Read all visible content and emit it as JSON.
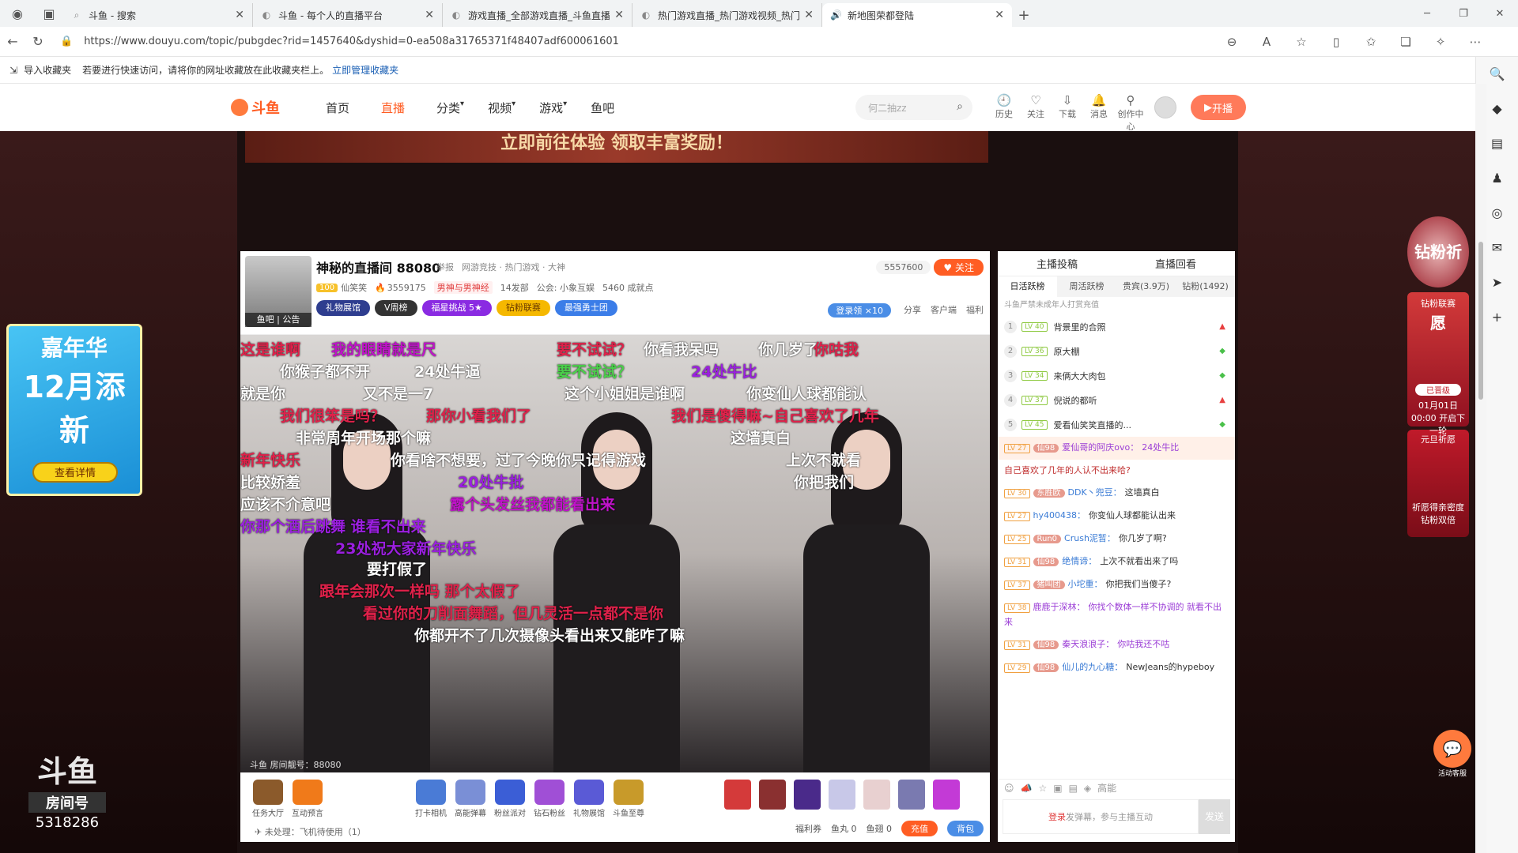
{
  "browser": {
    "tabs": [
      {
        "title": "斗鱼 - 搜索",
        "icon": "search-icon"
      },
      {
        "title": "斗鱼 - 每个人的直播平台",
        "icon": "douyu-icon"
      },
      {
        "title": "游戏直播_全部游戏直播_斗鱼直播",
        "icon": "douyu-icon"
      },
      {
        "title": "热门游戏直播_热门游戏视频_热门",
        "icon": "douyu-icon"
      },
      {
        "title": "新地图荣都登陆",
        "icon": "speaker-icon"
      }
    ],
    "url": "https://www.douyu.com/topic/pubgdec?rid=1457640&dyshid=0-ea508a31765371f48407adf600061601",
    "bookmarks": {
      "import": "导入收藏夹",
      "hint": "若要进行快速访问，请将你的网址收藏放在此收藏夹栏上。",
      "manage": "立即管理收藏夹"
    }
  },
  "site": {
    "logo": "斗鱼",
    "nav": [
      "首页",
      "直播",
      "分类",
      "视频",
      "游戏",
      "鱼吧"
    ],
    "active_nav": "直播",
    "search_placeholder": "何二抽zz",
    "top_icons": [
      "历史",
      "关注",
      "下载",
      "消息",
      "创作中心"
    ],
    "live_btn": "开播"
  },
  "banner_top": "立即前往体验 领取丰富奖励！",
  "left_promo": {
    "title": "嘉年华",
    "sub": "12月添新",
    "btn": "查看详情"
  },
  "room_number": {
    "logo": "斗鱼",
    "label": "房间号",
    "value": "5318286"
  },
  "room": {
    "title": "神秘的直播间 88080",
    "report": "举报",
    "category": "网游竞技 · 热门游戏 · 大神",
    "avatar_tag": "鱼吧 | 公告",
    "host_level": "100",
    "host_name": "仙笑笑",
    "hot": "3559175",
    "tag": "男神与男神经",
    "fans_club": "14发部",
    "guild": "公会: 小象互娱",
    "achievements": "5460 成就点",
    "badges": [
      "礼物展馆",
      "V周榜",
      "福星挑战 5★",
      "钻粉联赛",
      "最强勇士团"
    ],
    "follow_count": "5557600",
    "follow_btn": "关注",
    "login_badge": "登录领 ×10",
    "actions": [
      "分享",
      "客户端",
      "福利"
    ]
  },
  "danmaku": [
    {
      "t": "这是谁啊",
      "c": "#e0214a"
    },
    {
      "t": "我的眼睛就是尺",
      "c": "#c013c9"
    },
    {
      "t": "要不试试？",
      "c": "#e0214a"
    },
    {
      "t": "你看我呆吗",
      "c": "#ffffff"
    },
    {
      "t": "你几岁了",
      "c": "#ffffff"
    },
    {
      "t": "你猴子都不开",
      "c": "#ffffff"
    },
    {
      "t": "24处牛逼",
      "c": "#ffffff"
    },
    {
      "t": "要不试试？",
      "c": "#4ad14a"
    },
    {
      "t": "24处牛比",
      "c": "#9b1fe0"
    },
    {
      "t": "你咕我",
      "c": "#e0214a"
    },
    {
      "t": "就是你",
      "c": "#ffffff"
    },
    {
      "t": "又不是一7",
      "c": "#ffffff"
    },
    {
      "t": "这个小姐姐是谁啊",
      "c": "#ffffff"
    },
    {
      "t": "你变仙人球都能认",
      "c": "#ffffff"
    },
    {
      "t": "我们很笨是吗？",
      "c": "#e0214a"
    },
    {
      "t": "那你小看我们了",
      "c": "#e0214a"
    },
    {
      "t": "我们是傻得嘛~自己喜欢了几年",
      "c": "#e0214a"
    },
    {
      "t": "非常周年开场那个嘛",
      "c": "#ffffff"
    },
    {
      "t": "这墙真白",
      "c": "#ffffff"
    },
    {
      "t": "新年快乐",
      "c": "#e0214a"
    },
    {
      "t": "你看啥不想要，过了今晚你只记得游戏",
      "c": "#ffffff"
    },
    {
      "t": "上次不就看",
      "c": "#ffffff"
    },
    {
      "t": "比较娇羞",
      "c": "#ffffff"
    },
    {
      "t": "20处牛批",
      "c": "#9b1fe0"
    },
    {
      "t": "你把我们",
      "c": "#ffffff"
    },
    {
      "t": "应该不介意吧",
      "c": "#ffffff"
    },
    {
      "t": "露个头发丝我都能看出来",
      "c": "#c013c9"
    },
    {
      "t": "你那个酒后跳舞 谁看不出来",
      "c": "#9b1fe0"
    },
    {
      "t": "23处祝大家新年快乐",
      "c": "#9b1fe0"
    },
    {
      "t": "要打假了",
      "c": "#ffffff"
    },
    {
      "t": "跟年会那次一样吗 那个太假了",
      "c": "#e0214a"
    },
    {
      "t": "看过你的刀削面舞蹈，但几灵活一点都不是你",
      "c": "#e0214a"
    },
    {
      "t": "你都开不了几次摄像头看出来又能咋了嘛",
      "c": "#ffffff"
    }
  ],
  "video_watermark": "斗鱼 房间靓号：88080",
  "giftbar": {
    "left": [
      "任务大厅",
      "互动预言"
    ],
    "mid": [
      "打卡相机",
      "高能弹幕",
      "粉丝派对",
      "钻石粉丝",
      "礼物展馆",
      "斗鱼至尊"
    ],
    "pending": "未处理：飞机待使用（1）",
    "wallet": [
      "福利券",
      "鱼丸 0",
      "鱼翅 0"
    ],
    "charge": "充值",
    "bag": "背包"
  },
  "chat": {
    "top": [
      "主播投稿",
      "直播回看"
    ],
    "tabs": [
      "日活跃榜",
      "周活跃榜",
      "贵宾(3.9万)",
      "钻粉(1492)"
    ],
    "note": "斗鱼严禁未成年人打赏充值",
    "ranks": [
      {
        "n": "1",
        "lv": "LV 40",
        "name": "背景里的合照"
      },
      {
        "n": "2",
        "lv": "LV 36",
        "name": "原大棚"
      },
      {
        "n": "3",
        "lv": "LV 34",
        "name": "来俩大大肉包"
      },
      {
        "n": "4",
        "lv": "LV 37",
        "name": "倪说的都听"
      },
      {
        "n": "5",
        "lv": "LV 45",
        "name": "爱看仙笑笑直播的..."
      }
    ],
    "messages": [
      {
        "lv": "LV 27",
        "fan": "仙98",
        "name": "爱仙哥的阿庆ovo：",
        "text": "24处牛比",
        "p": true,
        "hl": true
      },
      {
        "lv": "",
        "fan": "",
        "name": "",
        "text": "自己喜欢了几年的人认不出来哈?",
        "p": false,
        "red": true
      },
      {
        "lv": "LV 30",
        "fan": "东胜欧",
        "name": "DDK丶兜豆：",
        "text": "这墙真白",
        "p": false
      },
      {
        "lv": "LV 27",
        "fan": "",
        "name": "hy400438：",
        "text": "你变仙人球都能认出来",
        "p": false
      },
      {
        "lv": "LV 25",
        "fan": "Run0",
        "name": "Crush泥暂：",
        "text": "你几岁了啊?",
        "p": false
      },
      {
        "lv": "LV 31",
        "fan": "仙98",
        "name": "绝情谛：",
        "text": "上次不就看出来了吗",
        "p": false
      },
      {
        "lv": "LV 37",
        "fan": "猪叫团",
        "name": "小坨重：",
        "text": "你把我们当傻子?",
        "p": false
      },
      {
        "lv": "LV 38",
        "fan": "",
        "name": "鹿鹿于深林：",
        "text": "你找个数体一样不协调的 就看不出来",
        "p": true
      },
      {
        "lv": "LV 31",
        "fan": "仙98",
        "name": "秦天浪浪子：",
        "text": "你咕我还不咕",
        "p": true
      },
      {
        "lv": "LV 29",
        "fan": "仙98",
        "name": "仙儿的九心糖：",
        "text": "NewJeans的hypeboy",
        "p": false
      }
    ],
    "tools": "高能",
    "input_login": "登录",
    "input_hint": "发弹幕，参与主播互动",
    "send": "发送"
  },
  "right_promo": {
    "r1": "钻粉祈愿",
    "r2_title": "钻粉联赛",
    "r2_label": "已晋级",
    "r2_time": "01月01日00:00 开启下一轮",
    "r3_title": "元旦祈愿",
    "r3_sub": "祈愿得亲密度 钻粉双倍"
  },
  "service": "活动客服"
}
